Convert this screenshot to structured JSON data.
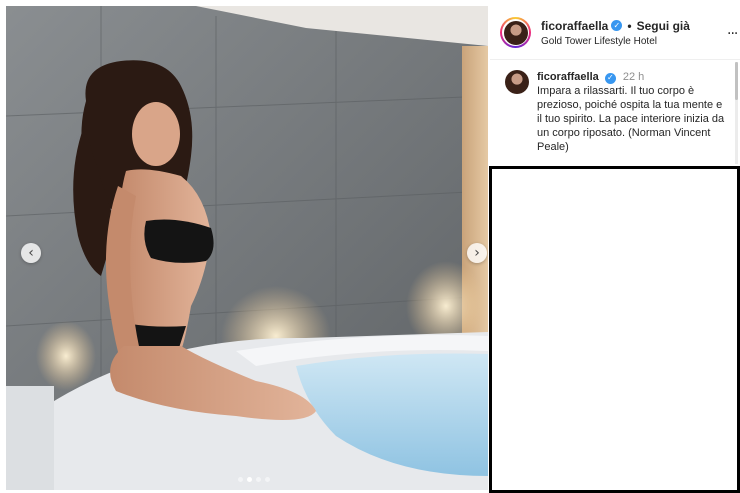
{
  "post": {
    "username": "ficoraffaella",
    "follow_label": "Segui già",
    "separator": "•",
    "location": "Gold Tower Lifestyle Hotel",
    "more_label": "..."
  },
  "caption": {
    "username": "ficoraffaella",
    "time": "22 h",
    "text": "Impara a rilassarti. Il tuo corpo è prezioso, poiché ospita la tua mente e il tuo spirito. La pace interiore inizia da un corpo riposato. (Norman Vincent Peale)"
  },
  "carousel": {
    "prev_icon": "chevron-left-icon",
    "next_icon": "chevron-right-icon",
    "prev_glyph": "‹",
    "next_glyph": "›",
    "slide_count": 4,
    "active_index": 1
  },
  "colors": {
    "verified": "#3897f0",
    "text": "#262626",
    "muted": "#8e8e8e"
  }
}
